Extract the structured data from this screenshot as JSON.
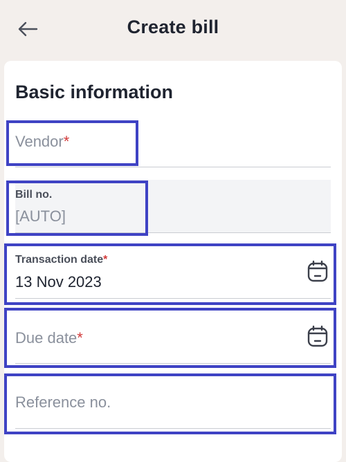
{
  "header": {
    "title": "Create bill",
    "back_icon": "arrow-left-icon"
  },
  "section": {
    "title": "Basic information"
  },
  "fields": {
    "vendor": {
      "placeholder": "Vendor",
      "required_mark": "*"
    },
    "bill_no": {
      "label": "Bill no.",
      "value": "[AUTO]"
    },
    "transaction_date": {
      "label": "Transaction date",
      "required_mark": "*",
      "value": "13 Nov 2023",
      "icon": "calendar-icon"
    },
    "due_date": {
      "placeholder": "Due date",
      "required_mark": "*",
      "icon": "calendar-icon"
    },
    "reference_no": {
      "placeholder": "Reference no."
    }
  },
  "colors": {
    "accent_highlight": "#3f43c4",
    "required": "#d23a3a",
    "background": "#f3efec"
  }
}
